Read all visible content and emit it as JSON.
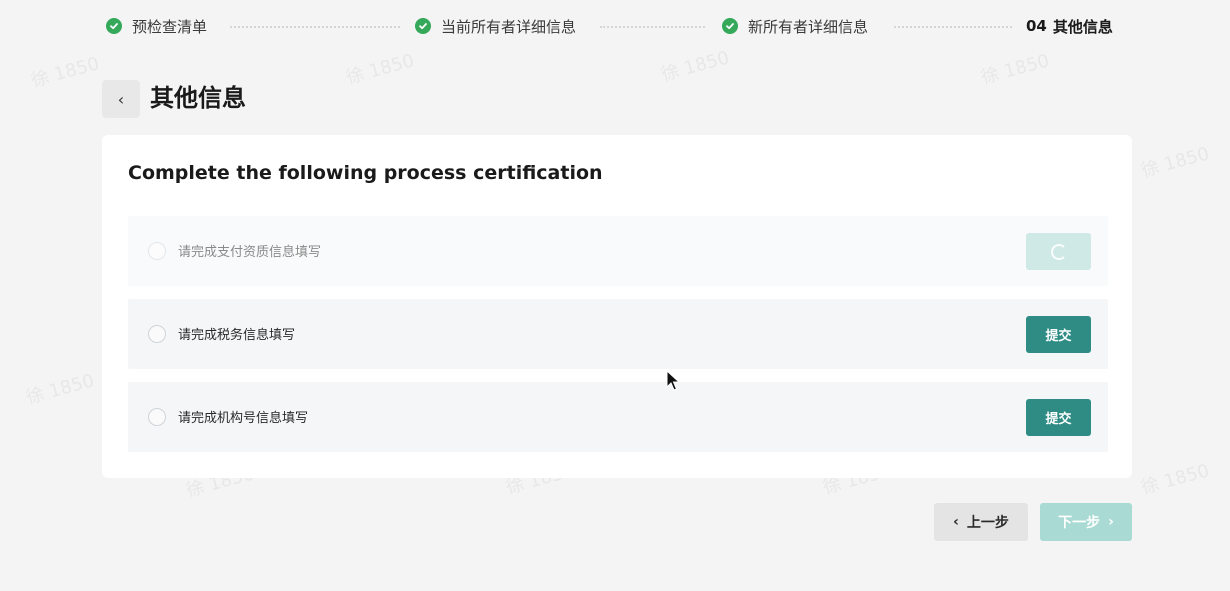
{
  "watermark": "徐 1850",
  "stepper": {
    "steps": [
      {
        "label": "预检查清单",
        "status": "done"
      },
      {
        "label": "当前所有者详细信息",
        "status": "done"
      },
      {
        "label": "新所有者详细信息",
        "status": "done"
      },
      {
        "number": "04",
        "label": "其他信息",
        "status": "current"
      }
    ]
  },
  "header": {
    "back_icon": "chevron-left-icon",
    "back_glyph": "‹",
    "title": "其他信息"
  },
  "card": {
    "title": "Complete the following process certification",
    "tasks": [
      {
        "label": "请完成支付资质信息填写",
        "action": "",
        "state": "loading"
      },
      {
        "label": "请完成税务信息填写",
        "action": "提交",
        "state": "ready"
      },
      {
        "label": "请完成机构号信息填写",
        "action": "提交",
        "state": "ready"
      }
    ]
  },
  "footer": {
    "prev_glyph": "‹",
    "prev_label": "上一步",
    "next_label": "下一步",
    "next_glyph": "›",
    "next_enabled": false
  },
  "colors": {
    "step_done": "#35a85a",
    "primary": "#2e8c85",
    "primary_disabled": "#a9dad4",
    "background": "#f4f4f4"
  }
}
